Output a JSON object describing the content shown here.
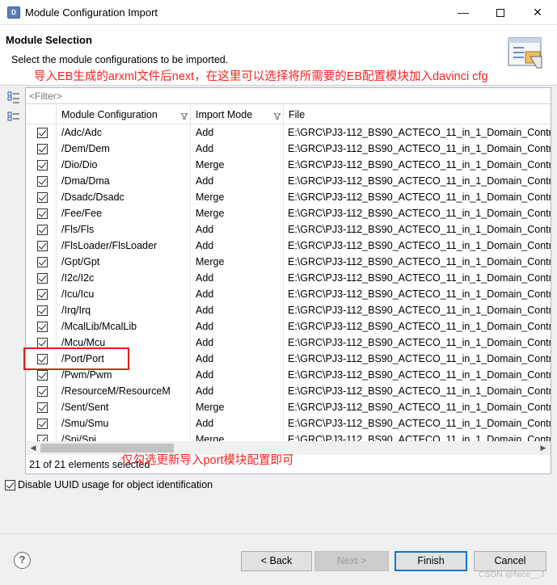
{
  "window": {
    "title": "Module Configuration Import"
  },
  "header": {
    "section_title": "Module Selection",
    "description": "Select the module configurations to be imported.",
    "annotation": "导入EB生成的arxml文件后next，在这里可以选择将所需要的EB配置模块加入davinci cfg"
  },
  "filter": {
    "placeholder": "<Filter>"
  },
  "table": {
    "columns": [
      "Module Configuration",
      "Import Mode",
      "File"
    ],
    "rows": [
      {
        "module": "/Adc/Adc",
        "mode": "Add",
        "file": "E:\\GRC\\PJ3-112_BS90_ACTECO_11_in_1_Domain_Contr",
        "checked": true
      },
      {
        "module": "/Dem/Dem",
        "mode": "Add",
        "file": "E:\\GRC\\PJ3-112_BS90_ACTECO_11_in_1_Domain_Contr",
        "checked": true
      },
      {
        "module": "/Dio/Dio",
        "mode": "Merge",
        "file": "E:\\GRC\\PJ3-112_BS90_ACTECO_11_in_1_Domain_Contr",
        "checked": true
      },
      {
        "module": "/Dma/Dma",
        "mode": "Add",
        "file": "E:\\GRC\\PJ3-112_BS90_ACTECO_11_in_1_Domain_Contr",
        "checked": true
      },
      {
        "module": "/Dsadc/Dsadc",
        "mode": "Merge",
        "file": "E:\\GRC\\PJ3-112_BS90_ACTECO_11_in_1_Domain_Contr",
        "checked": true
      },
      {
        "module": "/Fee/Fee",
        "mode": "Merge",
        "file": "E:\\GRC\\PJ3-112_BS90_ACTECO_11_in_1_Domain_Contr",
        "checked": true
      },
      {
        "module": "/Fls/Fls",
        "mode": "Add",
        "file": "E:\\GRC\\PJ3-112_BS90_ACTECO_11_in_1_Domain_Contr",
        "checked": true
      },
      {
        "module": "/FlsLoader/FlsLoader",
        "mode": "Add",
        "file": "E:\\GRC\\PJ3-112_BS90_ACTECO_11_in_1_Domain_Contr",
        "checked": true
      },
      {
        "module": "/Gpt/Gpt",
        "mode": "Merge",
        "file": "E:\\GRC\\PJ3-112_BS90_ACTECO_11_in_1_Domain_Contr",
        "checked": true
      },
      {
        "module": "/I2c/I2c",
        "mode": "Add",
        "file": "E:\\GRC\\PJ3-112_BS90_ACTECO_11_in_1_Domain_Contr",
        "checked": true
      },
      {
        "module": "/Icu/Icu",
        "mode": "Add",
        "file": "E:\\GRC\\PJ3-112_BS90_ACTECO_11_in_1_Domain_Contr",
        "checked": true
      },
      {
        "module": "/Irq/Irq",
        "mode": "Add",
        "file": "E:\\GRC\\PJ3-112_BS90_ACTECO_11_in_1_Domain_Contr",
        "checked": true
      },
      {
        "module": "/McalLib/McalLib",
        "mode": "Add",
        "file": "E:\\GRC\\PJ3-112_BS90_ACTECO_11_in_1_Domain_Contr",
        "checked": true
      },
      {
        "module": "/Mcu/Mcu",
        "mode": "Add",
        "file": "E:\\GRC\\PJ3-112_BS90_ACTECO_11_in_1_Domain_Contr",
        "checked": true
      },
      {
        "module": "/Port/Port",
        "mode": "Add",
        "file": "E:\\GRC\\PJ3-112_BS90_ACTECO_11_in_1_Domain_Contr",
        "checked": true
      },
      {
        "module": "/Pwm/Pwm",
        "mode": "Add",
        "file": "E:\\GRC\\PJ3-112_BS90_ACTECO_11_in_1_Domain_Contr",
        "checked": true
      },
      {
        "module": "/ResourceM/ResourceM",
        "mode": "Add",
        "file": "E:\\GRC\\PJ3-112_BS90_ACTECO_11_in_1_Domain_Contr",
        "checked": true
      },
      {
        "module": "/Sent/Sent",
        "mode": "Merge",
        "file": "E:\\GRC\\PJ3-112_BS90_ACTECO_11_in_1_Domain_Contr",
        "checked": true
      },
      {
        "module": "/Smu/Smu",
        "mode": "Add",
        "file": "E:\\GRC\\PJ3-112_BS90_ACTECO_11_in_1_Domain_Contr",
        "checked": true
      },
      {
        "module": "/Spi/Spi",
        "mode": "Merge",
        "file": "E:\\GRC\\PJ3-112_BS90_ACTECO_11_in_1_Domain_Contr",
        "checked": true
      }
    ],
    "selection_count": "21 of 21 elements selected",
    "annotation": "仅勾选更新导入port模块配置即可"
  },
  "options": {
    "uuid_label": "Disable UUID usage for object identification",
    "uuid_checked": true
  },
  "buttons": {
    "back": "< Back",
    "next": "Next >",
    "finish": "Finish",
    "cancel": "Cancel",
    "help": "?"
  },
  "watermark": "CSDN @Nice__J",
  "colors": {
    "annotation": "#ff2020",
    "focus": "#0078d7"
  }
}
